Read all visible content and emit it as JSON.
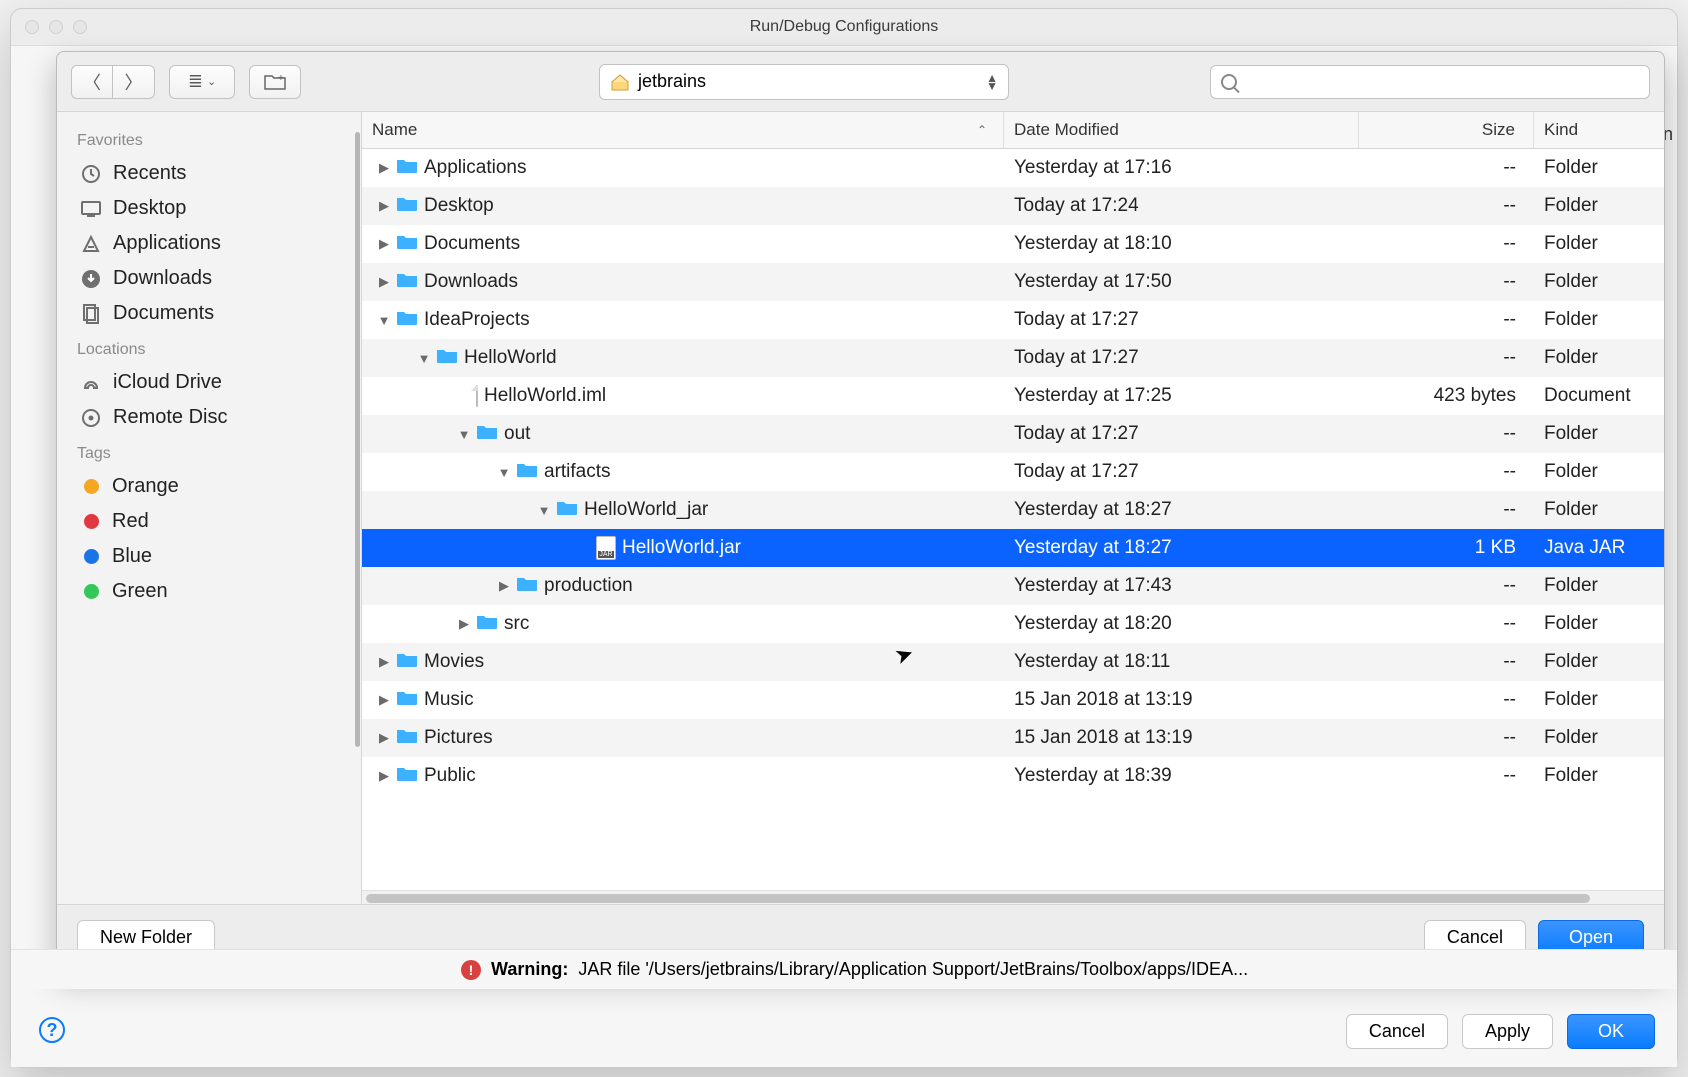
{
  "outer": {
    "title": "Run/Debug Configurations",
    "warning_label": "Warning:",
    "warning_text": "JAR file '/Users/jetbrains/Library/Application Support/JetBrains/Toolbox/apps/IDEA...",
    "buttons": {
      "cancel": "Cancel",
      "apply": "Apply",
      "ok": "OK"
    }
  },
  "sheet": {
    "location": "jetbrains",
    "search_placeholder": "",
    "footer": {
      "new_folder": "New Folder",
      "cancel": "Cancel",
      "open": "Open"
    }
  },
  "sidebar": {
    "favorites_label": "Favorites",
    "locations_label": "Locations",
    "tags_label": "Tags",
    "favorites": [
      {
        "label": "Recents"
      },
      {
        "label": "Desktop"
      },
      {
        "label": "Applications"
      },
      {
        "label": "Downloads"
      },
      {
        "label": "Documents"
      }
    ],
    "locations": [
      {
        "label": "iCloud Drive"
      },
      {
        "label": "Remote Disc"
      }
    ],
    "tags": [
      {
        "label": "Orange",
        "color": "#f5a623"
      },
      {
        "label": "Red",
        "color": "#e0383e"
      },
      {
        "label": "Blue",
        "color": "#1a73e8"
      },
      {
        "label": "Green",
        "color": "#34c759"
      }
    ]
  },
  "columns": {
    "name": "Name",
    "date": "Date Modified",
    "size": "Size",
    "kind": "Kind"
  },
  "rows": [
    {
      "indent": 0,
      "expander": "▶",
      "icon": "folder",
      "name": "Applications",
      "date": "Yesterday at 17:16",
      "size": "--",
      "kind": "Folder"
    },
    {
      "indent": 0,
      "expander": "▶",
      "icon": "folder",
      "name": "Desktop",
      "date": "Today at 17:24",
      "size": "--",
      "kind": "Folder"
    },
    {
      "indent": 0,
      "expander": "▶",
      "icon": "folder",
      "name": "Documents",
      "date": "Yesterday at 18:10",
      "size": "--",
      "kind": "Folder"
    },
    {
      "indent": 0,
      "expander": "▶",
      "icon": "folder",
      "name": "Downloads",
      "date": "Yesterday at 17:50",
      "size": "--",
      "kind": "Folder"
    },
    {
      "indent": 0,
      "expander": "▼",
      "icon": "folder",
      "name": "IdeaProjects",
      "date": "Today at 17:27",
      "size": "--",
      "kind": "Folder"
    },
    {
      "indent": 1,
      "expander": "▼",
      "icon": "folder",
      "name": "HelloWorld",
      "date": "Today at 17:27",
      "size": "--",
      "kind": "Folder"
    },
    {
      "indent": 2,
      "expander": "",
      "icon": "file",
      "name": "HelloWorld.iml",
      "date": "Yesterday at 17:25",
      "size": "423 bytes",
      "kind": "Document"
    },
    {
      "indent": 2,
      "expander": "▼",
      "icon": "folder",
      "name": "out",
      "date": "Today at 17:27",
      "size": "--",
      "kind": "Folder"
    },
    {
      "indent": 3,
      "expander": "▼",
      "icon": "folder",
      "name": "artifacts",
      "date": "Today at 17:27",
      "size": "--",
      "kind": "Folder"
    },
    {
      "indent": 4,
      "expander": "▼",
      "icon": "folder",
      "name": "HelloWorld_jar",
      "date": "Yesterday at 18:27",
      "size": "--",
      "kind": "Folder"
    },
    {
      "indent": 5,
      "expander": "",
      "icon": "jar",
      "name": "HelloWorld.jar",
      "date": "Yesterday at 18:27",
      "size": "1 KB",
      "kind": "Java JAR",
      "selected": true
    },
    {
      "indent": 3,
      "expander": "▶",
      "icon": "folder",
      "name": "production",
      "date": "Yesterday at 17:43",
      "size": "--",
      "kind": "Folder"
    },
    {
      "indent": 2,
      "expander": "▶",
      "icon": "folder",
      "name": "src",
      "date": "Yesterday at 18:20",
      "size": "--",
      "kind": "Folder"
    },
    {
      "indent": 0,
      "expander": "▶",
      "icon": "folder",
      "name": "Movies",
      "date": "Yesterday at 18:11",
      "size": "--",
      "kind": "Folder"
    },
    {
      "indent": 0,
      "expander": "▶",
      "icon": "folder",
      "name": "Music",
      "date": "15 Jan 2018 at 13:19",
      "size": "--",
      "kind": "Folder"
    },
    {
      "indent": 0,
      "expander": "▶",
      "icon": "folder",
      "name": "Pictures",
      "date": "15 Jan 2018 at 13:19",
      "size": "--",
      "kind": "Folder"
    },
    {
      "indent": 0,
      "expander": "▶",
      "icon": "folder",
      "name": "Public",
      "date": "Yesterday at 18:39",
      "size": "--",
      "kind": "Folder"
    }
  ]
}
